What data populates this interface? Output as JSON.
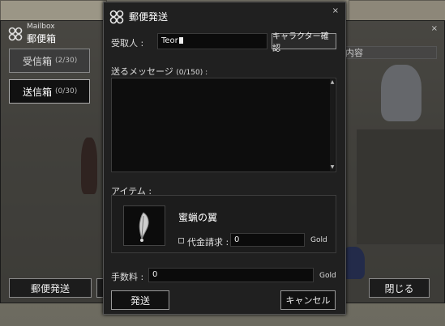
{
  "mailbox": {
    "subtitle": "Mailbox",
    "title": "郵便箱",
    "close": "×",
    "tabs": [
      {
        "label": "受信箱",
        "count": "(2/30)"
      },
      {
        "label": "送信箱",
        "count": "(0/30)"
      }
    ],
    "column_header": "内容",
    "send_button": "郵便発送",
    "close_button": "閉じる"
  },
  "dialog": {
    "title": "郵便発送",
    "close": "×",
    "recipient_label": "受取人 :",
    "recipient_value": "Teor",
    "check_character_button": "キャラクター確認",
    "message_label": "送るメッセージ",
    "message_count": "(0/150) :",
    "item_label": "アイテム :",
    "item_name": "蜜蝋の翼",
    "cod_label": "代金請求 :",
    "cod_value": "0",
    "gold_unit": "Gold",
    "fee_label": "手数料 :",
    "fee_value": "0",
    "send_button": "発送",
    "cancel_button": "キャンセル"
  },
  "icons": {
    "logo": "clover-logo-icon",
    "item": "feather-wing-icon"
  }
}
